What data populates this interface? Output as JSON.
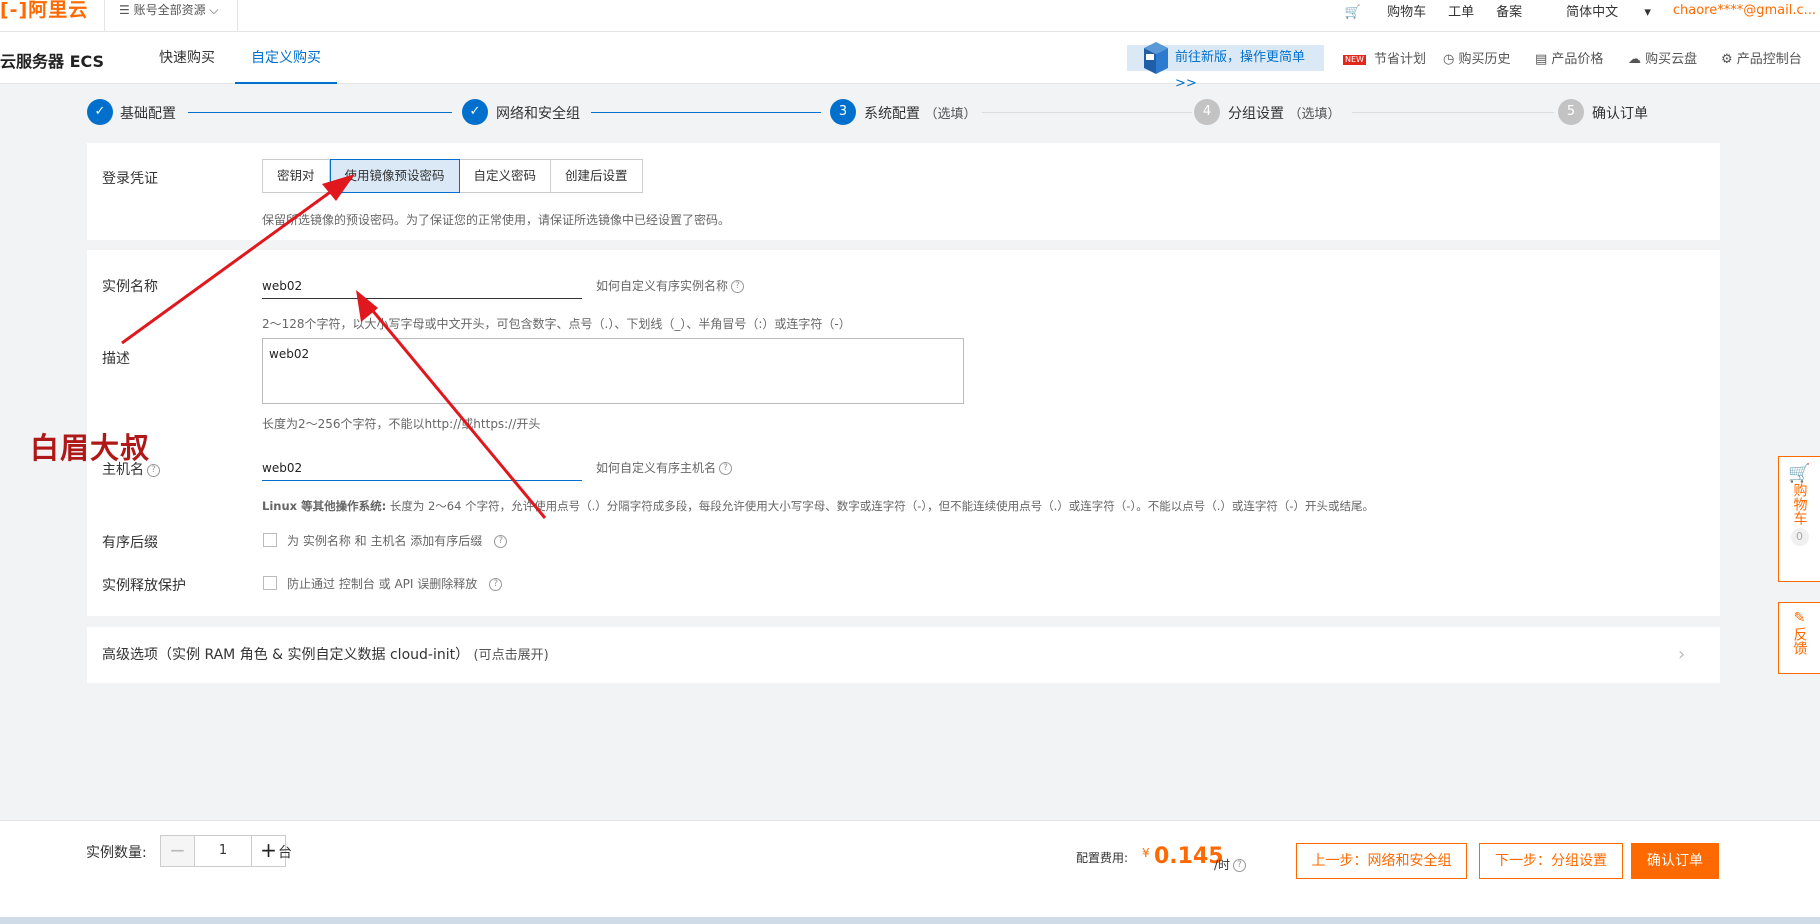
{
  "topbar": {
    "logo": "[-]阿里云",
    "account": "账号全部资源",
    "links": [
      "购物车",
      "工单",
      "备案",
      "简体中文"
    ],
    "email": "chaore****@gmail.c..."
  },
  "nav": {
    "product": "云服务器 ECS",
    "tabs": [
      "快速购买",
      "自定义购买"
    ],
    "promo": "前往新版，操作更简单>>",
    "new_badge": "NEW",
    "links": [
      "节省计划",
      "购买历史",
      "产品价格",
      "购买云盘",
      "产品控制台"
    ]
  },
  "steps": [
    {
      "num": "1",
      "label": "基础配置",
      "opt": ""
    },
    {
      "num": "2",
      "label": "网络和安全组",
      "opt": ""
    },
    {
      "num": "3",
      "label": "系统配置",
      "opt": "（选填）"
    },
    {
      "num": "4",
      "label": "分组设置",
      "opt": "（选填）"
    },
    {
      "num": "5",
      "label": "确认订单",
      "opt": ""
    }
  ],
  "login": {
    "label": "登录凭证",
    "options": [
      "密钥对",
      "使用镜像预设密码",
      "自定义密码",
      "创建后设置"
    ],
    "hint": "保留所选镜像的预设密码。为了保证您的正常使用，请保证所选镜像中已经设置了密码。"
  },
  "instance_name": {
    "label": "实例名称",
    "value": "web02",
    "help": "如何自定义有序实例名称",
    "hint": "2～128个字符，以大小写字母或中文开头，可包含数字、点号（.）、下划线（_）、半角冒号（:）或连字符（-）"
  },
  "description": {
    "label": "描述",
    "value": "web02",
    "hint": "长度为2～256个字符，不能以http://或https://开头"
  },
  "hostname": {
    "label": "主机名",
    "value": "web02",
    "help": "如何自定义有序主机名",
    "hint_bold": "Linux 等其他操作系统:",
    "hint": "长度为 2～64 个字符，允许使用点号（.）分隔字符成多段，每段允许使用大小写字母、数字或连字符（-），但不能连续使用点号（.）或连字符（-）。不能以点号（.）或连字符（-）开头或结尾。"
  },
  "ordered_suffix": {
    "label": "有序后缀",
    "text": "为 实例名称 和 主机名 添加有序后缀"
  },
  "release_protect": {
    "label": "实例释放保护",
    "text": "防止通过 控制台 或 API 误删除释放"
  },
  "advanced": {
    "label": "高级选项（实例 RAM 角色 & 实例自定义数据 cloud-init）",
    "hint": "(可点击展开)"
  },
  "side": {
    "cart": "购物车",
    "cart_count": "0",
    "feedback": "反馈"
  },
  "watermark": "白眉大叔",
  "bottom": {
    "qty_label": "实例数量:",
    "qty_value": "1",
    "qty_unit": "台",
    "fee_label": "配置费用:",
    "currency": "¥",
    "price": "0.145",
    "per": "/时",
    "prev": "上一步：网络和安全组",
    "next": "下一步：分组设置",
    "confirm": "确认订单"
  },
  "colors": {
    "accent": "#ff6a00",
    "primary": "#0070cc",
    "annotation": "#e0181e"
  }
}
